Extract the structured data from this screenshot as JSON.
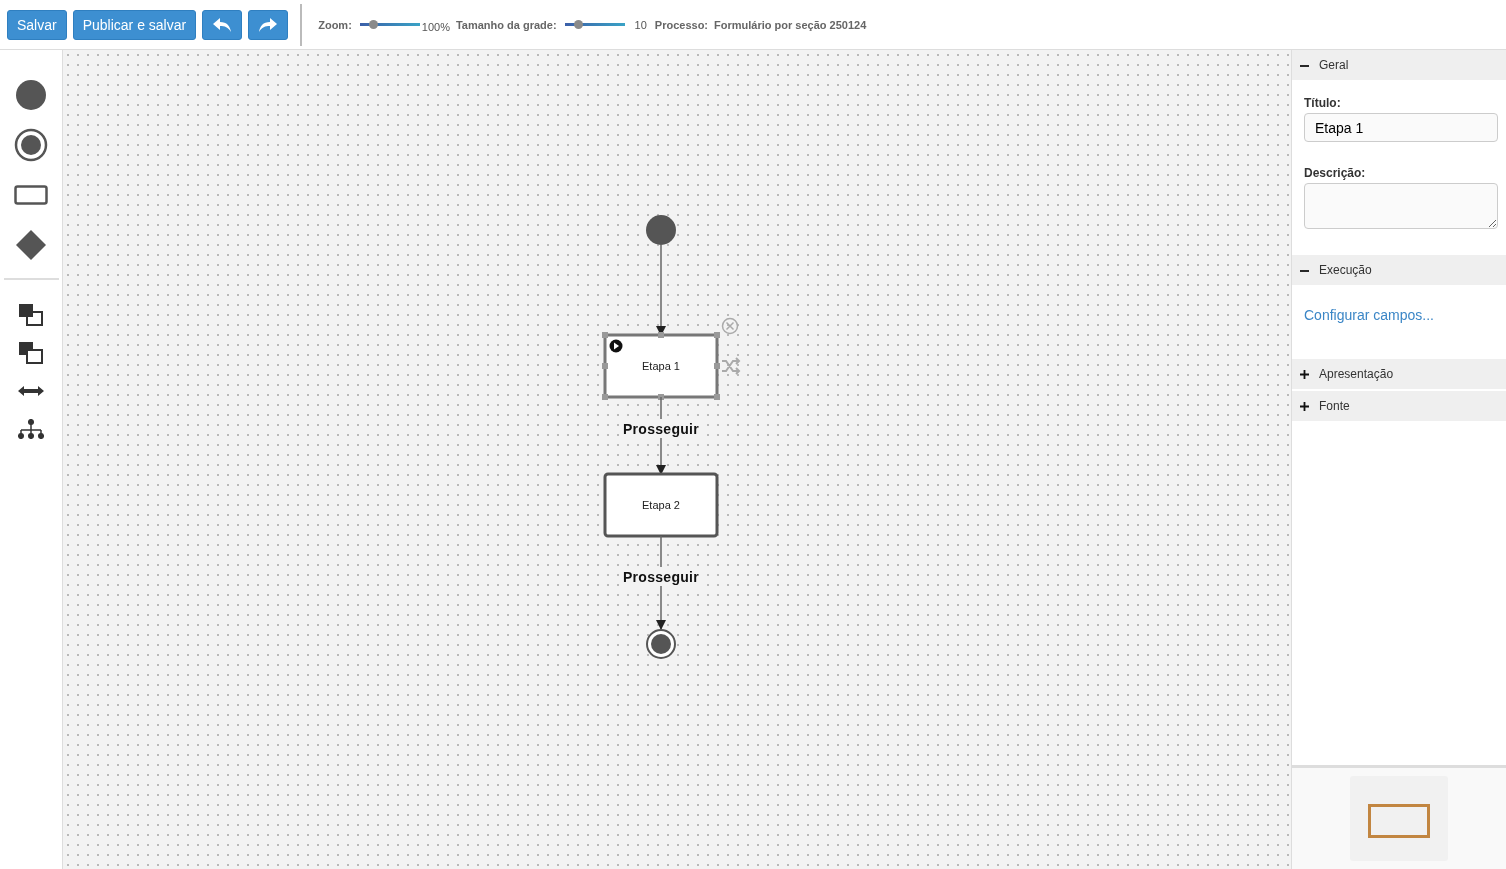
{
  "toolbar": {
    "buttons": [
      {
        "kind": "text",
        "label": "Salvar"
      },
      {
        "kind": "text",
        "label": "Publicar e salvar"
      },
      {
        "kind": "undo"
      },
      {
        "kind": "redo"
      }
    ],
    "zoom": {
      "label": "Zoom:",
      "level": 0.22,
      "reading": "100%"
    },
    "grid": {
      "label": "Tamanho da grade:",
      "level": 0.23,
      "reading": "10"
    },
    "process": {
      "label": "Processo:",
      "value": "Formulário por seção 250124"
    }
  },
  "palette": [
    {
      "kind": "start"
    },
    {
      "kind": "end"
    },
    {
      "kind": "task"
    },
    {
      "kind": "gateway"
    },
    {
      "kind": "front"
    },
    {
      "kind": "back"
    },
    {
      "kind": "hspace"
    },
    {
      "kind": "tree"
    }
  ],
  "diagram": {
    "nodes": [
      {
        "kind": "start"
      },
      {
        "kind": "task",
        "label": "Etapa 1",
        "selected": true
      },
      {
        "kind": "task",
        "label": "Etapa 2",
        "selected": false
      },
      {
        "kind": "end"
      }
    ],
    "edges": [
      {
        "kind": "plain"
      },
      {
        "kind": "labeled",
        "label": "Prosseguir"
      },
      {
        "kind": "labeled",
        "label": "Prosseguir"
      }
    ]
  },
  "panel": {
    "sections": [
      {
        "title": "Geral",
        "expanded": true,
        "fields": [
          {
            "kind": "input",
            "label": "Título:",
            "value": "Etapa 1"
          },
          {
            "kind": "textarea",
            "label": "Descrição:"
          }
        ]
      },
      {
        "title": "Execução",
        "expanded": true,
        "fields": [
          {
            "kind": "link",
            "value": "Configurar campos..."
          }
        ]
      },
      {
        "title": "Apresentação",
        "expanded": false
      },
      {
        "title": "Fonte",
        "expanded": false
      }
    ]
  }
}
